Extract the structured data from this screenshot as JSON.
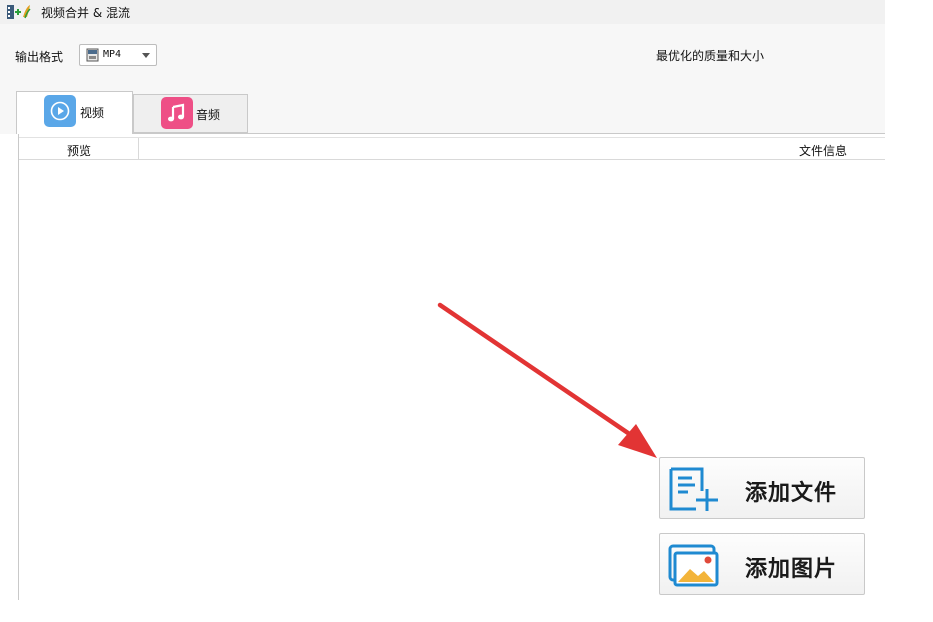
{
  "window": {
    "title": "视频合并 & 混流"
  },
  "toolbar": {
    "format_label": "输出格式",
    "format_value": "MP4",
    "quality_text": "最优化的质量和大小"
  },
  "tabs": [
    {
      "label": "视频",
      "icon": "play-circle-icon",
      "color": "#5aa7e8",
      "active": true
    },
    {
      "label": "音频",
      "icon": "music-note-icon",
      "color": "#ee4f86",
      "active": false
    }
  ],
  "list": {
    "columns": [
      "预览",
      "文件信息"
    ]
  },
  "buttons": {
    "add_file": "添加文件",
    "add_image": "添加图片"
  },
  "colors": {
    "accent_blue": "#1f8ad1",
    "annotation_arrow": "#e23434"
  }
}
